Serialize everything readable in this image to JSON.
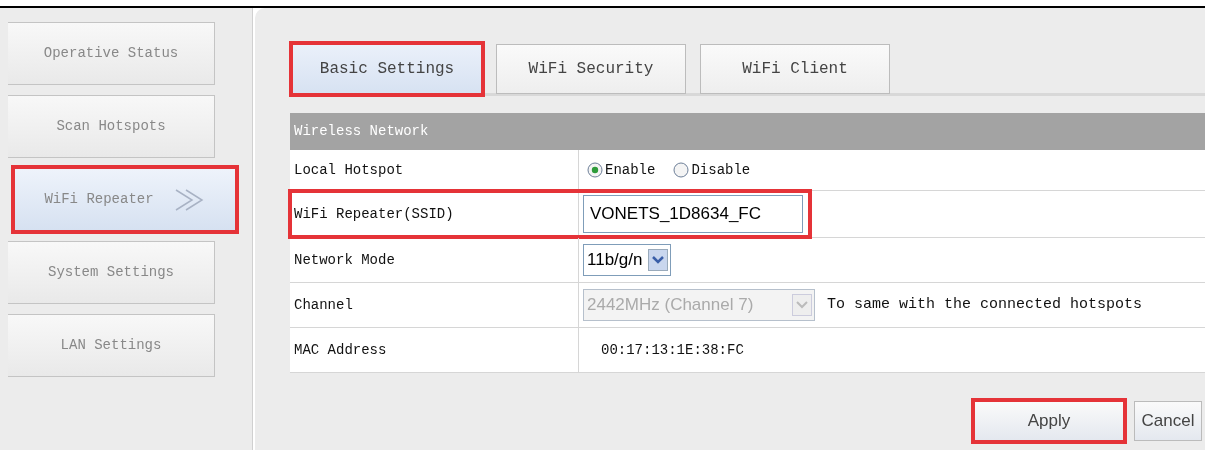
{
  "sidebar": {
    "items": [
      {
        "label": "Operative Status",
        "selected": false,
        "highlighted": false
      },
      {
        "label": "Scan Hotspots",
        "selected": false,
        "highlighted": false
      },
      {
        "label": "WiFi Repeater",
        "selected": true,
        "highlighted": true
      },
      {
        "label": "System Settings",
        "selected": false,
        "highlighted": false
      },
      {
        "label": "LAN Settings",
        "selected": false,
        "highlighted": false
      }
    ]
  },
  "tabs": [
    {
      "label": "Basic Settings",
      "selected": true,
      "highlighted": true
    },
    {
      "label": "WiFi Security",
      "selected": false,
      "highlighted": false
    },
    {
      "label": "WiFi Client",
      "selected": false,
      "highlighted": false
    }
  ],
  "section": {
    "title": "Wireless Network"
  },
  "rows": [
    {
      "kind": "radio",
      "label": "Local Hotspot",
      "highlighted": false,
      "options": [
        {
          "label": "Enable",
          "selected": true
        },
        {
          "label": "Disable",
          "selected": false
        }
      ]
    },
    {
      "kind": "input",
      "label": "WiFi Repeater(SSID)",
      "highlighted": true,
      "value": "VONETS_1D8634_FC"
    },
    {
      "kind": "select",
      "label": "Network Mode",
      "highlighted": false,
      "value": "11b/g/n",
      "disabled": false
    },
    {
      "kind": "select",
      "label": "Channel",
      "highlighted": false,
      "value": "2442MHz (Channel 7)",
      "disabled": true,
      "note": "To same with the connected hotspots"
    },
    {
      "kind": "text",
      "label": "MAC Address",
      "highlighted": false,
      "value": "00:17:13:1E:38:FC"
    }
  ],
  "buttons": [
    {
      "label": "Apply",
      "highlighted": true
    },
    {
      "label": "Cancel",
      "highlighted": false
    }
  ]
}
